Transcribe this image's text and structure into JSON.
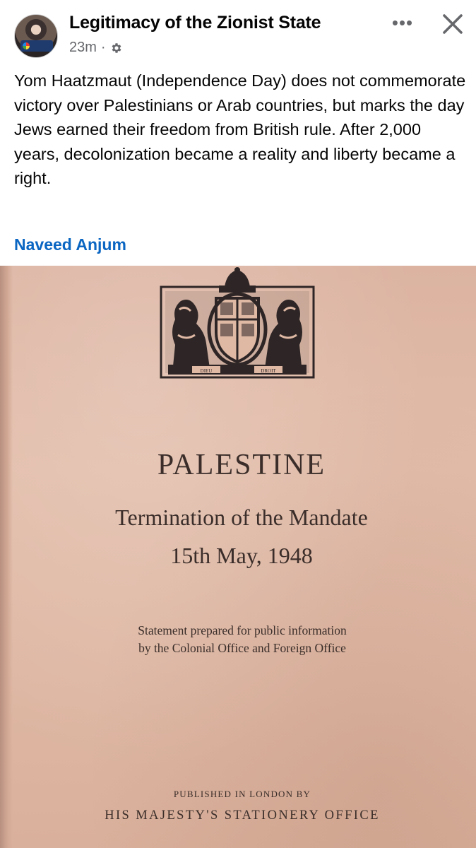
{
  "post": {
    "group_name": "Legitimacy of the Zionist State",
    "timestamp": "23m",
    "separator": "·",
    "privacy_icon": "gear-icon",
    "more_label": "•••",
    "body": "Yom Haatzmaut (Independence Day) does not commemorate victory over Palestinians or Arab countries, but marks the day Jews earned their freedom from British rule. After 2,000 years, decolonization became a reality and liberty became a right.",
    "author_mention": "Naveed Anjum"
  },
  "photo": {
    "title": "PALESTINE",
    "subtitle": "Termination of the Mandate",
    "date": "15th May, 1948",
    "statement_line1": "Statement prepared for public information",
    "statement_line2": "by the Colonial Office and Foreign Office",
    "published": "PUBLISHED IN LONDON BY",
    "office": "HIS MAJESTY'S STATIONERY OFFICE",
    "emblem_motto_left": "DIEU",
    "emblem_motto_right": "DROIT"
  },
  "colors": {
    "link_blue": "#0a66c2",
    "meta_gray": "#65676b",
    "paper": "#e0b9a5",
    "ink": "#3b2e2a"
  }
}
